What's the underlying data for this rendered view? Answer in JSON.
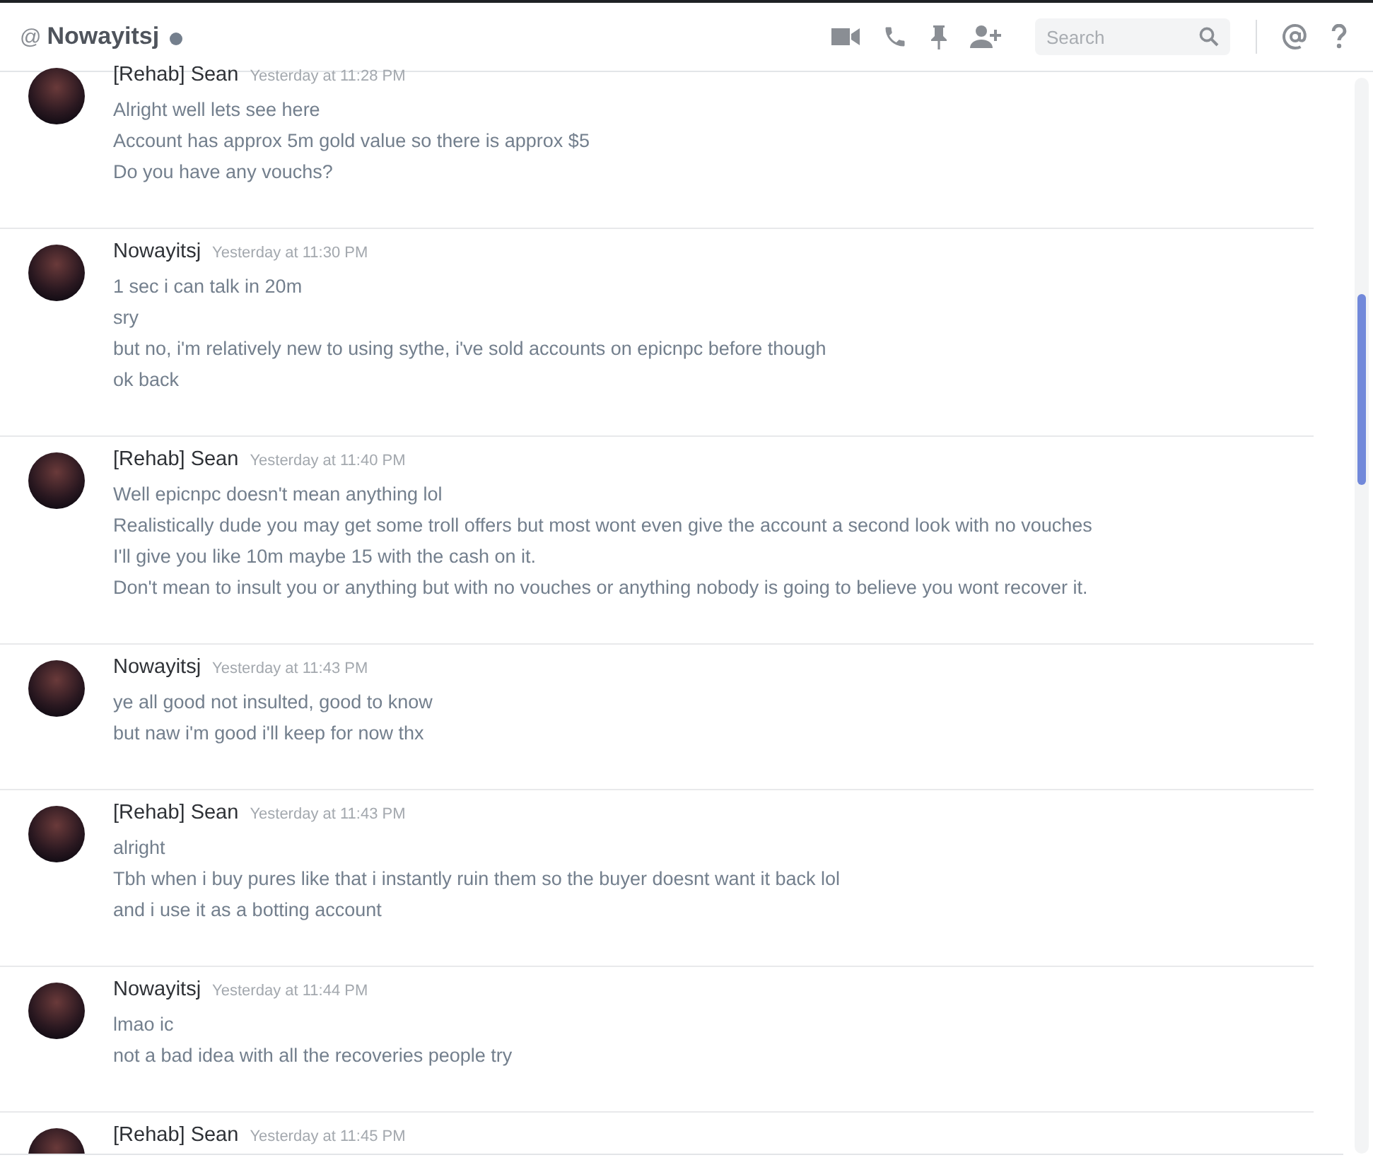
{
  "header": {
    "at": "@",
    "title": "Nowayitsj",
    "search": {
      "placeholder": "Search"
    }
  },
  "messages": [
    {
      "author": "[Rehab] Sean",
      "timestamp": "Yesterday at 11:28 PM",
      "lines": [
        "Alright well lets see here",
        "Account has approx 5m gold value so there is approx $5",
        "Do you have any vouchs?"
      ]
    },
    {
      "author": "Nowayitsj",
      "timestamp": "Yesterday at 11:30 PM",
      "lines": [
        "1 sec i can talk in 20m",
        "sry",
        "but no, i'm relatively new to using sythe, i've sold accounts on epicnpc before though",
        "ok back"
      ]
    },
    {
      "author": "[Rehab] Sean",
      "timestamp": "Yesterday at 11:40 PM",
      "lines": [
        "Well epicnpc doesn't mean anything lol",
        "Realistically dude you may get some troll offers but most wont even give the account a second look with no vouches",
        "I'll give you like 10m maybe 15 with the cash on it.",
        "Don't mean to insult you or anything but with no vouches or anything nobody is going to believe you wont recover it."
      ]
    },
    {
      "author": "Nowayitsj",
      "timestamp": "Yesterday at 11:43 PM",
      "lines": [
        "ye all good not insulted, good to know",
        "but naw i'm good i'll keep for now thx"
      ]
    },
    {
      "author": "[Rehab] Sean",
      "timestamp": "Yesterday at 11:43 PM",
      "lines": [
        "alright",
        "Tbh when i buy pures like that i instantly ruin them so the buyer doesnt want it back lol",
        "and i use it as a botting account"
      ]
    },
    {
      "author": "Nowayitsj",
      "timestamp": "Yesterday at 11:44 PM",
      "lines": [
        "lmao ic",
        "not a bad idea with all the recoveries people try"
      ]
    },
    {
      "author": "[Rehab] Sean",
      "timestamp": "Yesterday at 11:45 PM"
    }
  ]
}
